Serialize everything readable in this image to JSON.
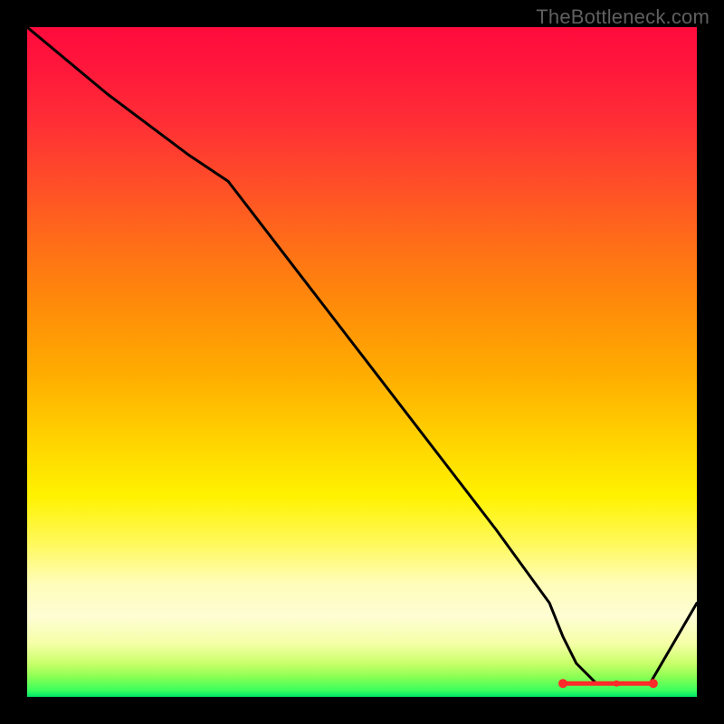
{
  "credit": "TheBottleneck.com",
  "colors": {
    "background": "#000000",
    "credit_text": "#5f5f5f",
    "curve": "#000000",
    "marker": "#ff2a2a"
  },
  "chart_data": {
    "type": "line",
    "title": "",
    "xlabel": "",
    "ylabel": "",
    "xlim": [
      0,
      100
    ],
    "ylim": [
      0,
      100
    ],
    "grid": false,
    "legend": false,
    "series": [
      {
        "name": "bottleneck-curve",
        "x": [
          0,
          12,
          24,
          30,
          40,
          50,
          60,
          70,
          78,
          80,
          82,
          85,
          88,
          90,
          93,
          100
        ],
        "values": [
          100,
          90,
          81,
          77,
          64,
          51,
          38,
          25,
          14,
          9,
          5,
          2,
          2,
          2,
          2,
          14
        ]
      }
    ],
    "markers": {
      "name": "optimum-band",
      "x": [
        80,
        82,
        84,
        86,
        88,
        90,
        92,
        93.5
      ],
      "values": [
        2,
        2,
        2,
        2,
        2,
        2,
        2,
        2
      ]
    },
    "background_gradient_stops": [
      {
        "pos": 0.0,
        "color": "#ff0b3d"
      },
      {
        "pos": 0.5,
        "color": "#ffad00"
      },
      {
        "pos": 0.7,
        "color": "#fff200"
      },
      {
        "pos": 0.88,
        "color": "#fefdd4"
      },
      {
        "pos": 1.0,
        "color": "#00e66a"
      }
    ]
  }
}
